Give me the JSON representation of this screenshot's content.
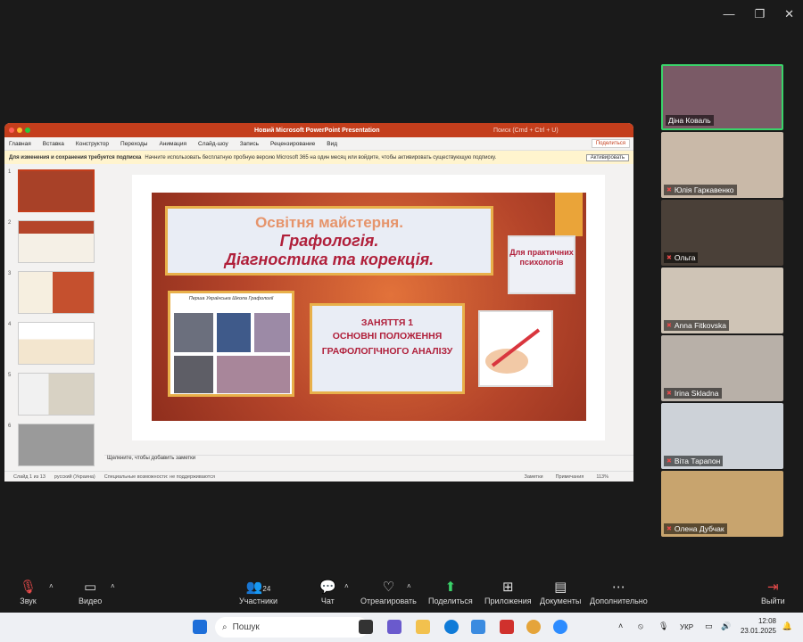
{
  "ppt": {
    "title": "Новий Microsoft PowerPoint Presentation",
    "search": "Поиск (Cmd + Ctrl + U)",
    "menu": [
      "Главная",
      "Вставка",
      "Конструктор",
      "Переходы",
      "Анимация",
      "Слайд-шоу",
      "Запись",
      "Рецензирование",
      "Вид"
    ],
    "share": "Поделиться",
    "notice_bold": "Для изменения и сохранения требуется подписка",
    "notice_text": "Начните использовать бесплатную пробную версию Microsoft 365 на один месяц или войдите, чтобы активировать существующую подписку.",
    "activate": "Активировать",
    "thumb_numbers": [
      "1",
      "2",
      "3",
      "4",
      "5",
      "6"
    ],
    "notes": "Щелкните, чтобы добавить заметки",
    "status_slide": "Слайд 1 из 13",
    "status_lang": "русский (Украина)",
    "status_access": "Специальные возможности: не поддерживаются",
    "status_notes": "Заметки",
    "status_comments": "Примечания",
    "zoom": "113%"
  },
  "slide": {
    "line1": "Освітня майстерня.",
    "line2": "Графологія.",
    "line3": "Діагностика та корекція.",
    "for": "Для практичних психологів",
    "school": "Перша Українська Школа Графології",
    "lesson1": "ЗАНЯТТЯ 1",
    "lesson2": "ОСНОВНІ ПОЛОЖЕННЯ",
    "lesson3": "ГРАФОЛОГІЧНОГО АНАЛІЗУ"
  },
  "participants": [
    {
      "name": "Діна Коваль",
      "muted": false,
      "bg": "#7a5a66"
    },
    {
      "name": "Юлія Гаркавенко",
      "muted": true,
      "bg": "#c9b9a8"
    },
    {
      "name": "Ольга",
      "muted": true,
      "bg": "#4a4038"
    },
    {
      "name": "Anna Fitkovska",
      "muted": true,
      "bg": "#cfc4b6"
    },
    {
      "name": "Irina Skladna",
      "muted": true,
      "bg": "#b8b0a8"
    },
    {
      "name": "Віта Тарапон",
      "muted": true,
      "bg": "#cdd2d8"
    },
    {
      "name": "Олена Дубчак",
      "muted": true,
      "bg": "#c8a46e"
    }
  ],
  "zoom_bar": {
    "audio": "Звук",
    "video": "Видео",
    "participants": "Участники",
    "participants_count": "24",
    "chat": "Чат",
    "react": "Отреагировать",
    "share": "Поделиться",
    "apps": "Приложения",
    "docs": "Документы",
    "more": "Дополнительно",
    "leave": "Выйти"
  },
  "taskbar": {
    "search": "Пошук",
    "lang": "УКР",
    "time": "12:08",
    "date": "23.01.2025"
  }
}
